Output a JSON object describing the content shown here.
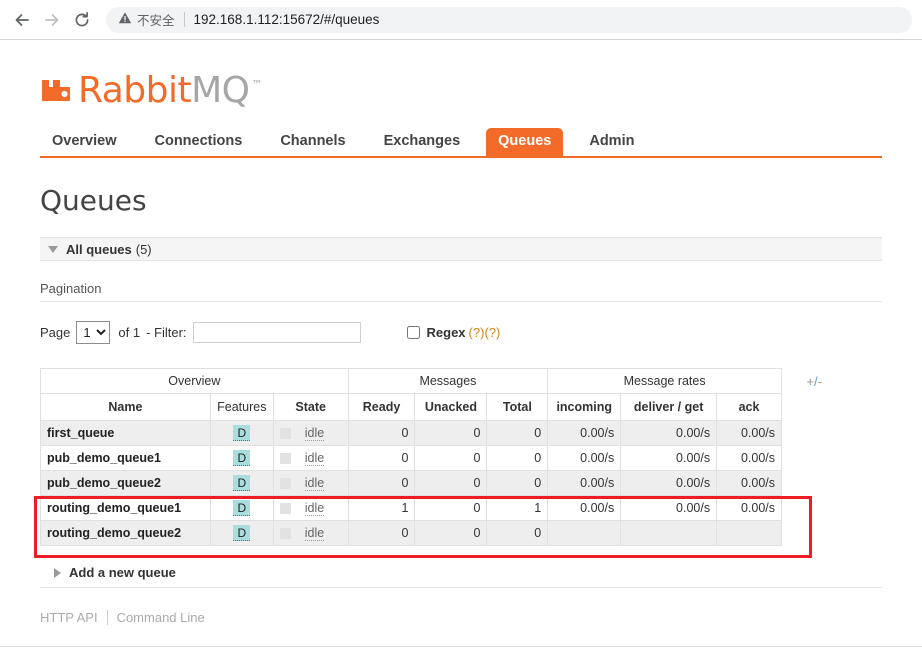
{
  "browser": {
    "back_icon": "arrow-left-icon",
    "forward_icon": "arrow-right-icon",
    "reload_icon": "reload-icon",
    "security_icon": "warning-triangle-icon",
    "security_text": "不安全",
    "url": "192.168.1.112:15672/#/queues"
  },
  "logo": {
    "mark": "rabbitmq-logo-icon",
    "word_primary": "Rabbit",
    "word_secondary": "MQ",
    "trademark": "™",
    "color_primary": "#f26b28",
    "color_secondary": "#a6a6a6"
  },
  "nav": {
    "accent_color": "#f26b28",
    "items": [
      {
        "label": "Overview",
        "active": false
      },
      {
        "label": "Connections",
        "active": false
      },
      {
        "label": "Channels",
        "active": false
      },
      {
        "label": "Exchanges",
        "active": false
      },
      {
        "label": "Queues",
        "active": true
      },
      {
        "label": "Admin",
        "active": false
      }
    ]
  },
  "page": {
    "title": "Queues"
  },
  "all_queues_section": {
    "label": "All queues",
    "count": "(5)",
    "expanded": true
  },
  "pagination": {
    "heading": "Pagination",
    "page_label": "Page",
    "page_value": "1",
    "page_options": [
      "1"
    ],
    "of_text": "of 1",
    "filter_label": "- Filter:",
    "filter_value": "",
    "filter_placeholder": "",
    "regex_label": "Regex",
    "regex_checked": false,
    "help_link_1": "(?)",
    "help_link_2": "(?)"
  },
  "table": {
    "plus_minus": "+/-",
    "group_headers": [
      {
        "label": "Overview",
        "span": 3
      },
      {
        "label": "Messages",
        "span": 3
      },
      {
        "label": "Message rates",
        "span": 3
      }
    ],
    "columns": [
      {
        "label": "Name",
        "sortable": true
      },
      {
        "label": "Features",
        "sortable": false
      },
      {
        "label": "State",
        "sortable": true
      },
      {
        "label": "Ready",
        "sortable": true
      },
      {
        "label": "Unacked",
        "sortable": true
      },
      {
        "label": "Total",
        "sortable": true
      },
      {
        "label": "incoming",
        "sortable": true
      },
      {
        "label": "deliver / get",
        "sortable": true
      },
      {
        "label": "ack",
        "sortable": true
      }
    ],
    "rows": [
      {
        "name": "first_queue",
        "features": "D",
        "state": "idle",
        "ready": "0",
        "unacked": "0",
        "total": "0",
        "incoming": "0.00/s",
        "deliver_get": "0.00/s",
        "ack": "0.00/s"
      },
      {
        "name": "pub_demo_queue1",
        "features": "D",
        "state": "idle",
        "ready": "0",
        "unacked": "0",
        "total": "0",
        "incoming": "0.00/s",
        "deliver_get": "0.00/s",
        "ack": "0.00/s"
      },
      {
        "name": "pub_demo_queue2",
        "features": "D",
        "state": "idle",
        "ready": "0",
        "unacked": "0",
        "total": "0",
        "incoming": "0.00/s",
        "deliver_get": "0.00/s",
        "ack": "0.00/s"
      },
      {
        "name": "routing_demo_queue1",
        "features": "D",
        "state": "idle",
        "ready": "1",
        "unacked": "0",
        "total": "1",
        "incoming": "0.00/s",
        "deliver_get": "0.00/s",
        "ack": "0.00/s"
      },
      {
        "name": "routing_demo_queue2",
        "features": "D",
        "state": "idle",
        "ready": "0",
        "unacked": "0",
        "total": "0",
        "incoming": "",
        "deliver_get": "",
        "ack": ""
      }
    ],
    "badge_color": "#aadddd",
    "annotation_color": "#ee1c24"
  },
  "add_queue": {
    "label": "Add a new queue",
    "expanded": false
  },
  "footer": {
    "http_api": "HTTP API",
    "command_line": "Command Line"
  }
}
